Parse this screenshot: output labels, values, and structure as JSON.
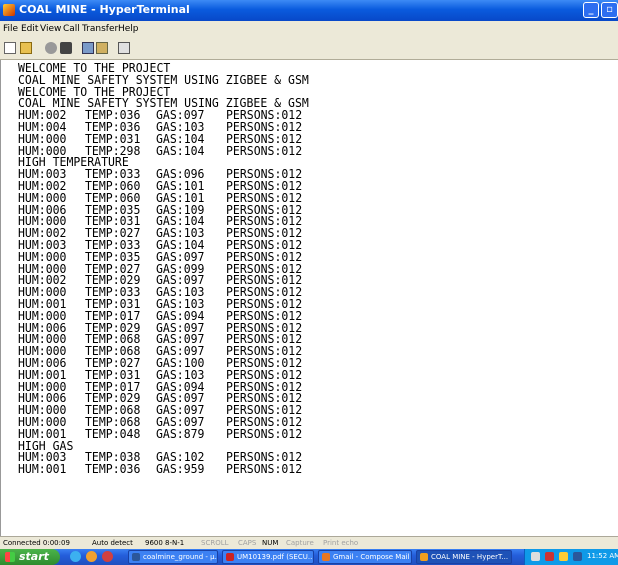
{
  "window": {
    "title": "COAL MINE - HyperTerminal"
  },
  "menu": [
    "File",
    "Edit",
    "View",
    "Call",
    "Transfer",
    "Help"
  ],
  "toolbar": [
    "new-icon",
    "open-icon",
    "call-icon",
    "disconnect-icon",
    "send-icon",
    "receive-icon",
    "properties-icon"
  ],
  "terminal": {
    "lines": [
      "WELCOME TO THE PROJECT",
      "COAL MINE SAFETY SYSTEM USING ZIGBEE & GSM",
      "WELCOME TO THE PROJECT",
      "COAL MINE SAFETY SYSTEM USING ZIGBEE & GSM",
      [
        "HUM:002",
        "TEMP:036",
        "GAS:097",
        "PERSONS:012"
      ],
      [
        "HUM:004",
        "TEMP:036",
        "GAS:103",
        "PERSONS:012"
      ],
      [
        "HUM:000",
        "TEMP:031",
        "GAS:104",
        "PERSONS:012"
      ],
      [
        "HUM:000",
        "TEMP:298",
        "GAS:104",
        "PERSONS:012"
      ],
      "HIGH TEMPERATURE",
      [
        "HUM:003",
        "TEMP:033",
        "GAS:096",
        "PERSONS:012"
      ],
      [
        "HUM:002",
        "TEMP:060",
        "GAS:101",
        "PERSONS:012"
      ],
      [
        "HUM:000",
        "TEMP:060",
        "GAS:101",
        "PERSONS:012"
      ],
      [
        "HUM:006",
        "TEMP:035",
        "GAS:109",
        "PERSONS:012"
      ],
      [
        "HUM:000",
        "TEMP:031",
        "GAS:104",
        "PERSONS:012"
      ],
      [
        "HUM:002",
        "TEMP:027",
        "GAS:103",
        "PERSONS:012"
      ],
      [
        "HUM:003",
        "TEMP:033",
        "GAS:104",
        "PERSONS:012"
      ],
      [
        "HUM:000",
        "TEMP:035",
        "GAS:097",
        "PERSONS:012"
      ],
      [
        "HUM:000",
        "TEMP:027",
        "GAS:099",
        "PERSONS:012"
      ],
      [
        "HUM:002",
        "TEMP:029",
        "GAS:097",
        "PERSONS:012"
      ],
      [
        "HUM:000",
        "TEMP:033",
        "GAS:103",
        "PERSONS:012"
      ],
      [
        "HUM:001",
        "TEMP:031",
        "GAS:103",
        "PERSONS:012"
      ],
      [
        "HUM:000",
        "TEMP:017",
        "GAS:094",
        "PERSONS:012"
      ],
      [
        "HUM:006",
        "TEMP:029",
        "GAS:097",
        "PERSONS:012"
      ],
      [
        "HUM:000",
        "TEMP:068",
        "GAS:097",
        "PERSONS:012"
      ],
      [
        "HUM:000",
        "TEMP:068",
        "GAS:097",
        "PERSONS:012"
      ],
      [
        "HUM:006",
        "TEMP:027",
        "GAS:100",
        "PERSONS:012"
      ],
      [
        "HUM:001",
        "TEMP:031",
        "GAS:103",
        "PERSONS:012"
      ],
      [
        "HUM:000",
        "TEMP:017",
        "GAS:094",
        "PERSONS:012"
      ],
      [
        "HUM:006",
        "TEMP:029",
        "GAS:097",
        "PERSONS:012"
      ],
      [
        "HUM:000",
        "TEMP:068",
        "GAS:097",
        "PERSONS:012"
      ],
      [
        "HUM:000",
        "TEMP:068",
        "GAS:097",
        "PERSONS:012"
      ],
      [
        "HUM:001",
        "TEMP:048",
        "GAS:879",
        "PERSONS:012"
      ],
      "HIGH GAS",
      [
        "HUM:003",
        "TEMP:038",
        "GAS:102",
        "PERSONS:012"
      ],
      [
        "HUM:001",
        "TEMP:036",
        "GAS:959",
        "PERSONS:012"
      ]
    ]
  },
  "status": {
    "connected": "Connected 0:00:09",
    "detect": "Auto detect",
    "settings": "9600 8-N-1",
    "scroll": "SCROLL",
    "caps": "CAPS",
    "num": "NUM",
    "capture": "Capture",
    "print": "Print echo"
  },
  "taskbar": {
    "start": "start",
    "tasks": [
      {
        "label": "coalmine_ground - µ...",
        "icon": "word-icon",
        "color": "#2b579a"
      },
      {
        "label": "UM10139.pdf (SECU...",
        "icon": "pdf-icon",
        "color": "#cc2222"
      },
      {
        "label": "Gmail - Compose Mail ...",
        "icon": "browser-icon",
        "color": "#e87722"
      },
      {
        "label": "COAL MINE - HyperT...",
        "icon": "hyperterminal-icon",
        "color": "#f0a020",
        "active": true
      }
    ],
    "clock": "11:52 AM"
  }
}
